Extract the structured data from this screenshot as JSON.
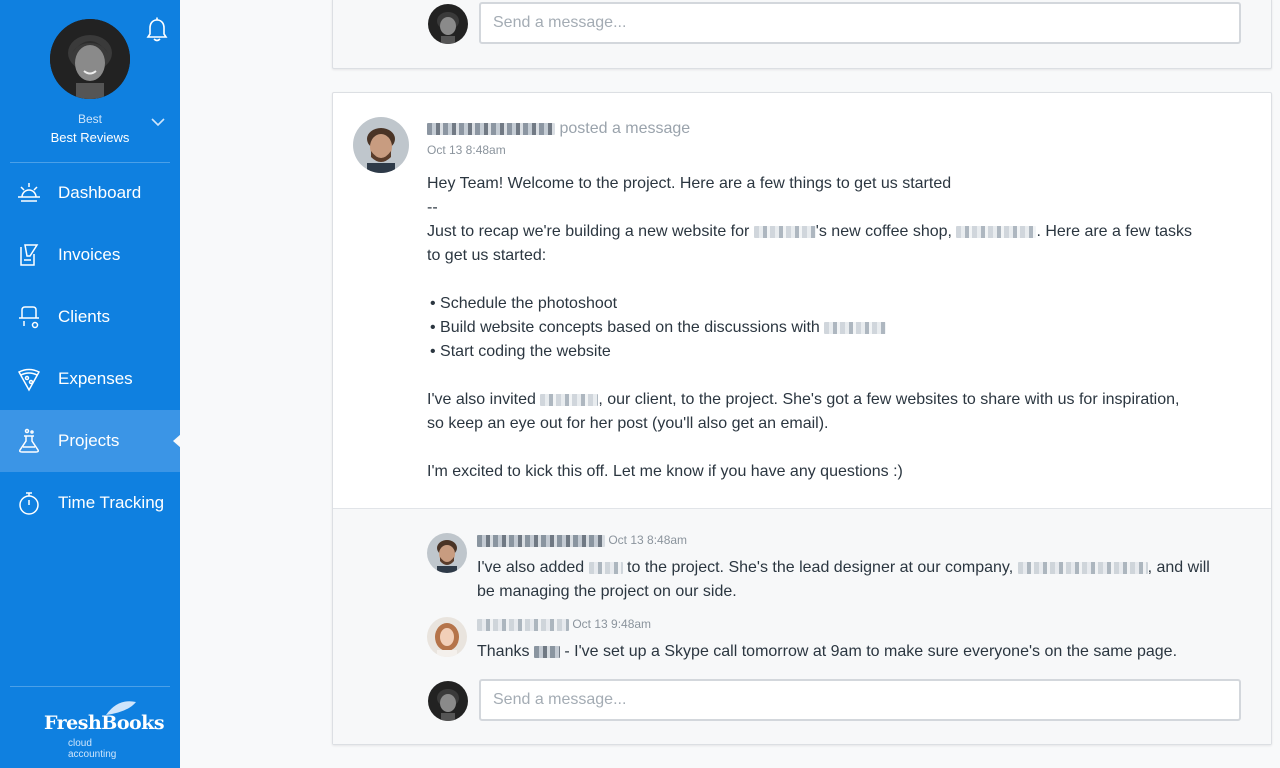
{
  "sidebar": {
    "user_name": "Best",
    "business_name": "Best Reviews",
    "nav": [
      {
        "label": "Dashboard",
        "icon": "sun-icon"
      },
      {
        "label": "Invoices",
        "icon": "invoice-icon"
      },
      {
        "label": "Clients",
        "icon": "client-icon"
      },
      {
        "label": "Expenses",
        "icon": "pizza-icon"
      },
      {
        "label": "Projects",
        "icon": "flask-icon",
        "active": true
      },
      {
        "label": "Time Tracking",
        "icon": "stopwatch-icon"
      }
    ],
    "logo_text": "FreshBooks",
    "logo_sub": "cloud accounting"
  },
  "top_card": {
    "input_placeholder": "Send a message..."
  },
  "post": {
    "action": "posted a message",
    "time": "Oct 13 8:48am",
    "lines": {
      "l1": "Hey Team! Welcome to the project. Here are a few things to get us started",
      "l2": "--",
      "l3a": "Just to recap we're building a new website for",
      "l3b": "'s new coffee shop,",
      "l3c": ". Here are a few tasks",
      "l4": "to get us started:",
      "b1": "• Schedule the photoshoot",
      "b2": "• Build website concepts based on the discussions with",
      "b3": "• Start coding the website",
      "p2a": "I've also invited",
      "p2b": ", our client, to the project. She's got a few websites to share with us for inspiration,",
      "p2c": "so keep an eye out for her post (you'll also get an email).",
      "p3": "I'm excited to kick this off. Let me know if you have any questions :)"
    }
  },
  "replies": [
    {
      "time": "Oct 13 8:48am",
      "t1": "I've also added",
      "t2": "to the project. She's the lead designer at our company,",
      "t3": ", and will",
      "t4": "be managing the project on our side."
    },
    {
      "time": "Oct 13 9:48am",
      "t1": "Thanks",
      "t2": "- I've set up a Skype call tomorrow at 9am to make sure everyone's on the same page."
    }
  ],
  "reply_input_placeholder": "Send a message...",
  "colors": {
    "sidebar": "#0f80e0",
    "active_nav": "#3b95e6",
    "text": "#2b3640",
    "muted": "#9aa3ac"
  }
}
